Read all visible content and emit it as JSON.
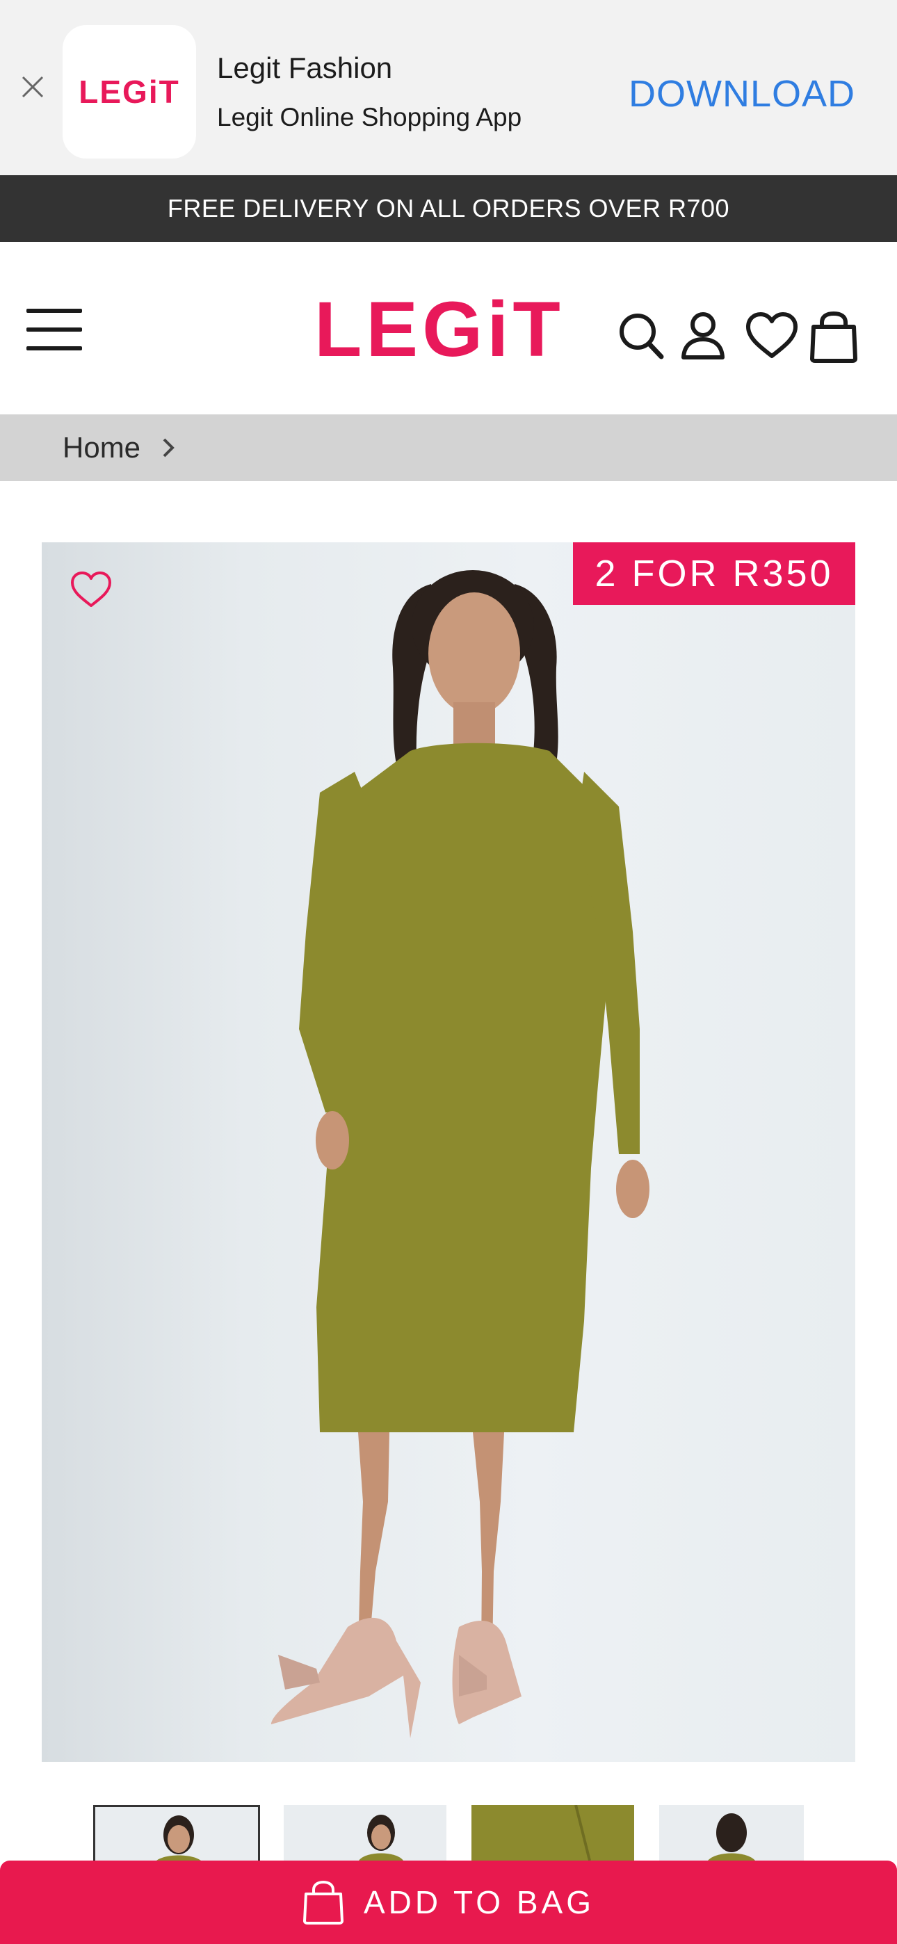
{
  "app_banner": {
    "app_name": "Legit Fashion",
    "app_description": "Legit Online Shopping App",
    "icon_logo_text": "LEGiT",
    "download_label": "DOWNLOAD"
  },
  "promo_bar": {
    "text": "FREE DELIVERY ON ALL ORDERS OVER R700"
  },
  "header": {
    "logo_text": "LEGiT",
    "icons": [
      "menu-icon",
      "search-icon",
      "account-icon",
      "heart-icon",
      "shopping-bag-icon"
    ]
  },
  "breadcrumb": {
    "items": [
      {
        "label": "Home"
      }
    ]
  },
  "product": {
    "promo_badge": "2 FOR R350",
    "dress_color": "#8c8a2e"
  },
  "thumbnails": {
    "count_visible": 4,
    "active_index": 0
  },
  "cta": {
    "add_to_bag_label": "ADD TO BAG"
  },
  "colors": {
    "brand": "#e8195a",
    "cta": "#e8194e",
    "download_link": "#2f7de1",
    "promo_bar_bg": "#333333",
    "breadcrumb_bg": "#d3d3d3"
  }
}
